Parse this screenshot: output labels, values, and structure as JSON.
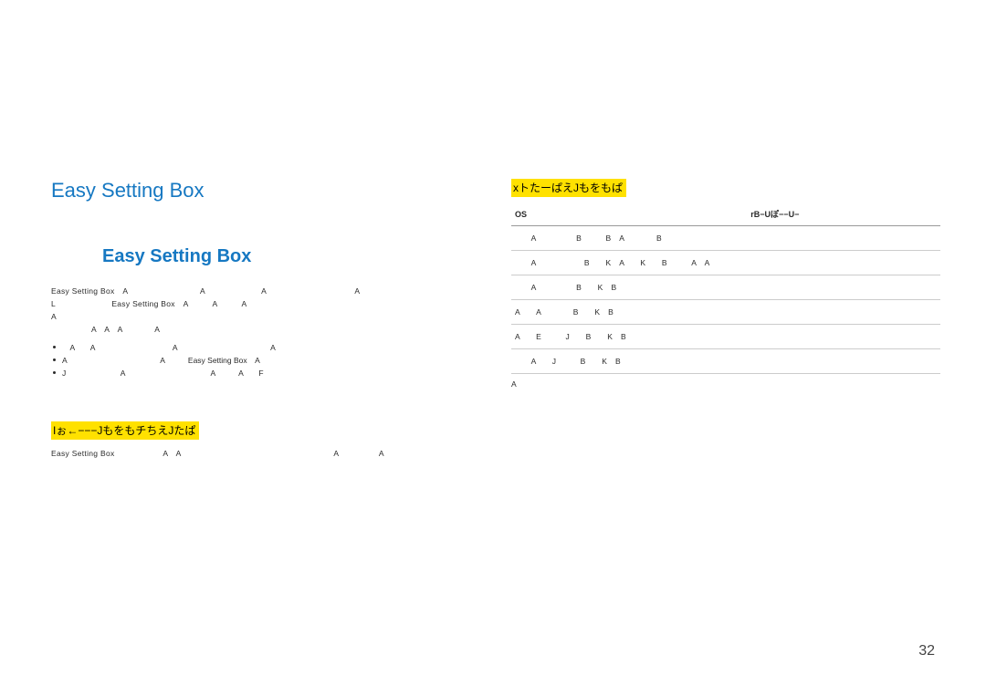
{
  "title": "Easy Setting Box",
  "logo": "Easy Setting Box",
  "description_lines": [
    "Easy Setting Box　A　　　　　　　　　A　　　　　　　A　　　　　　　　　　　A",
    "L　　　　　　　Easy Setting Box　A　　　A　　　A　　　　　　　　　　　　　　　　　",
    "A　　　　",
    "　　　　　A　A　A　　　　A"
  ],
  "bullets": [
    "　A　　A　　　　　　　　　　A　　　　　　　　　　　　A　　　",
    "A　　　　　　　　　　　　A　　　Easy Setting Box　A　　　　　　",
    "J　　　　　　　A　　　　　　　　　　　A　　　A　　F"
  ],
  "restrictions_title": "Iぉ←−−−JもをもチちえJたぱ",
  "restrictions_text": "Easy Setting Box　　　　　　A　A　　　　　　　　　　　　　　　　　　　A　　　　　A",
  "sysreq_title": "xトたーぱえJもをもぱ",
  "table": {
    "headers": [
      "OS",
      "rB−Uぽ−−U−"
    ],
    "rows": [
      [
        "　　A　　　　　B　　　B　A　　　　B",
        ""
      ],
      [
        "　　A　　　　　　B　　K　A　　K　　B　　　A　A　　　　",
        ""
      ],
      [
        "　　A　　　　　B　　K　B",
        ""
      ],
      [
        "A　　A　　　　B　　K　B",
        ""
      ],
      [
        "A　　E　　　J　　B　　K　B",
        ""
      ],
      [
        "　　A　　J　　　B　　K　B",
        ""
      ]
    ],
    "footnote": "A　　"
  },
  "page_number": "32"
}
